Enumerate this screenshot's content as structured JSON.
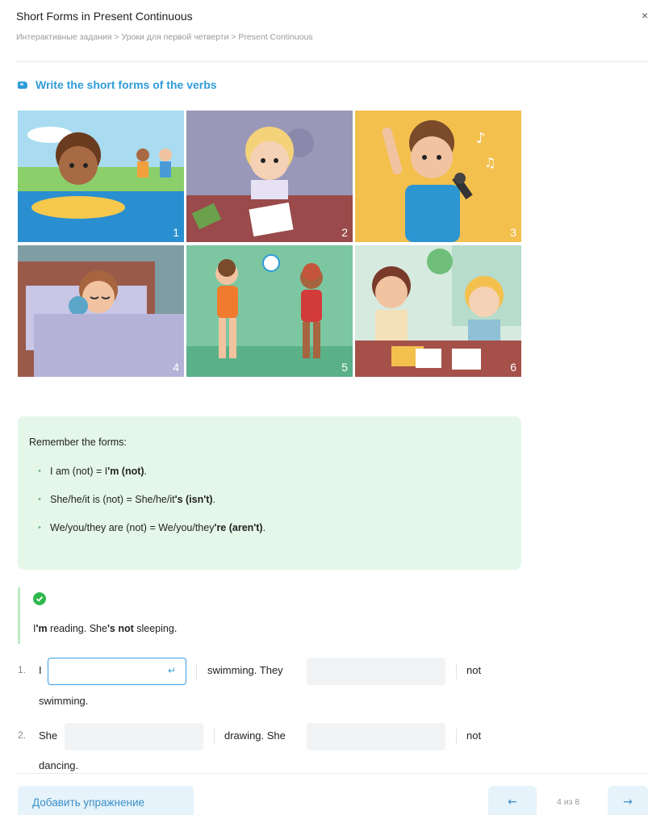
{
  "header": {
    "title": "Short Forms in Present Continuous",
    "breadcrumb": "Интерактивные задания > Уроки для первой четверти > Present Continuous",
    "close_glyph": "×"
  },
  "task": {
    "title": "Write the short forms of the verbs",
    "icon": "chat-icon"
  },
  "images": [
    {
      "number": "1",
      "scene": "boy swimming",
      "bg": "#7cc8e8"
    },
    {
      "number": "2",
      "scene": "girl drawing",
      "bg": "#9a98b8"
    },
    {
      "number": "3",
      "scene": "boy singing",
      "bg": "#f3c04e"
    },
    {
      "number": "4",
      "scene": "boy sleeping",
      "bg": "#7f9ea4"
    },
    {
      "number": "5",
      "scene": "boys playing ball",
      "bg": "#7cc7a2"
    },
    {
      "number": "6",
      "scene": "girls reading",
      "bg": "#d6eae0"
    }
  ],
  "remember": {
    "heading": "Remember the forms:",
    "items": [
      {
        "plain": "I am (not) = I",
        "bold": "'m (not)",
        "tail": "."
      },
      {
        "plain": "She/he/it is (not) = She/he/it",
        "bold": "'s (isn't)",
        "tail": "."
      },
      {
        "plain": "We/you/they are (not) = We/you/they",
        "bold": "'re (aren't)",
        "tail": "."
      }
    ]
  },
  "example": {
    "part1": "I",
    "bold1": "'m",
    "part2": " reading. She",
    "bold2": "'s not",
    "part3": " sleeping."
  },
  "exercises": [
    {
      "number": "1.",
      "subject": "I",
      "middle": "swimming. They",
      "after": "not",
      "wrap": "swimming."
    },
    {
      "number": "2.",
      "subject": "She",
      "middle": "drawing. She",
      "after": "not",
      "wrap": "dancing."
    }
  ],
  "footer": {
    "add_label": "Добавить упражнение",
    "prev_glyph": "←",
    "next_glyph": "→",
    "pager": "4 из 8"
  },
  "colors": {
    "accent": "#2f9bd8",
    "success": "#2db84d",
    "remember_bg": "#e4f7e8"
  }
}
